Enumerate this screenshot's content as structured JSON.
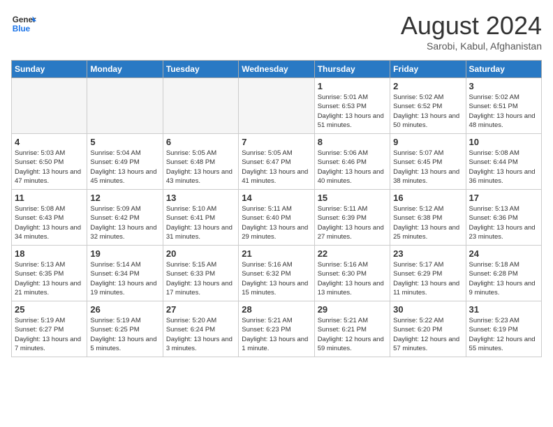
{
  "header": {
    "logo_line1": "General",
    "logo_line2": "Blue",
    "title": "August 2024",
    "subtitle": "Sarobi, Kabul, Afghanistan"
  },
  "days_of_week": [
    "Sunday",
    "Monday",
    "Tuesday",
    "Wednesday",
    "Thursday",
    "Friday",
    "Saturday"
  ],
  "weeks": [
    [
      {
        "num": "",
        "sunrise": "",
        "sunset": "",
        "daylight": "",
        "empty": true
      },
      {
        "num": "",
        "sunrise": "",
        "sunset": "",
        "daylight": "",
        "empty": true
      },
      {
        "num": "",
        "sunrise": "",
        "sunset": "",
        "daylight": "",
        "empty": true
      },
      {
        "num": "",
        "sunrise": "",
        "sunset": "",
        "daylight": "",
        "empty": true
      },
      {
        "num": "1",
        "sunrise": "Sunrise: 5:01 AM",
        "sunset": "Sunset: 6:53 PM",
        "daylight": "Daylight: 13 hours and 51 minutes."
      },
      {
        "num": "2",
        "sunrise": "Sunrise: 5:02 AM",
        "sunset": "Sunset: 6:52 PM",
        "daylight": "Daylight: 13 hours and 50 minutes."
      },
      {
        "num": "3",
        "sunrise": "Sunrise: 5:02 AM",
        "sunset": "Sunset: 6:51 PM",
        "daylight": "Daylight: 13 hours and 48 minutes."
      }
    ],
    [
      {
        "num": "4",
        "sunrise": "Sunrise: 5:03 AM",
        "sunset": "Sunset: 6:50 PM",
        "daylight": "Daylight: 13 hours and 47 minutes."
      },
      {
        "num": "5",
        "sunrise": "Sunrise: 5:04 AM",
        "sunset": "Sunset: 6:49 PM",
        "daylight": "Daylight: 13 hours and 45 minutes."
      },
      {
        "num": "6",
        "sunrise": "Sunrise: 5:05 AM",
        "sunset": "Sunset: 6:48 PM",
        "daylight": "Daylight: 13 hours and 43 minutes."
      },
      {
        "num": "7",
        "sunrise": "Sunrise: 5:05 AM",
        "sunset": "Sunset: 6:47 PM",
        "daylight": "Daylight: 13 hours and 41 minutes."
      },
      {
        "num": "8",
        "sunrise": "Sunrise: 5:06 AM",
        "sunset": "Sunset: 6:46 PM",
        "daylight": "Daylight: 13 hours and 40 minutes."
      },
      {
        "num": "9",
        "sunrise": "Sunrise: 5:07 AM",
        "sunset": "Sunset: 6:45 PM",
        "daylight": "Daylight: 13 hours and 38 minutes."
      },
      {
        "num": "10",
        "sunrise": "Sunrise: 5:08 AM",
        "sunset": "Sunset: 6:44 PM",
        "daylight": "Daylight: 13 hours and 36 minutes."
      }
    ],
    [
      {
        "num": "11",
        "sunrise": "Sunrise: 5:08 AM",
        "sunset": "Sunset: 6:43 PM",
        "daylight": "Daylight: 13 hours and 34 minutes."
      },
      {
        "num": "12",
        "sunrise": "Sunrise: 5:09 AM",
        "sunset": "Sunset: 6:42 PM",
        "daylight": "Daylight: 13 hours and 32 minutes."
      },
      {
        "num": "13",
        "sunrise": "Sunrise: 5:10 AM",
        "sunset": "Sunset: 6:41 PM",
        "daylight": "Daylight: 13 hours and 31 minutes."
      },
      {
        "num": "14",
        "sunrise": "Sunrise: 5:11 AM",
        "sunset": "Sunset: 6:40 PM",
        "daylight": "Daylight: 13 hours and 29 minutes."
      },
      {
        "num": "15",
        "sunrise": "Sunrise: 5:11 AM",
        "sunset": "Sunset: 6:39 PM",
        "daylight": "Daylight: 13 hours and 27 minutes."
      },
      {
        "num": "16",
        "sunrise": "Sunrise: 5:12 AM",
        "sunset": "Sunset: 6:38 PM",
        "daylight": "Daylight: 13 hours and 25 minutes."
      },
      {
        "num": "17",
        "sunrise": "Sunrise: 5:13 AM",
        "sunset": "Sunset: 6:36 PM",
        "daylight": "Daylight: 13 hours and 23 minutes."
      }
    ],
    [
      {
        "num": "18",
        "sunrise": "Sunrise: 5:13 AM",
        "sunset": "Sunset: 6:35 PM",
        "daylight": "Daylight: 13 hours and 21 minutes."
      },
      {
        "num": "19",
        "sunrise": "Sunrise: 5:14 AM",
        "sunset": "Sunset: 6:34 PM",
        "daylight": "Daylight: 13 hours and 19 minutes."
      },
      {
        "num": "20",
        "sunrise": "Sunrise: 5:15 AM",
        "sunset": "Sunset: 6:33 PM",
        "daylight": "Daylight: 13 hours and 17 minutes."
      },
      {
        "num": "21",
        "sunrise": "Sunrise: 5:16 AM",
        "sunset": "Sunset: 6:32 PM",
        "daylight": "Daylight: 13 hours and 15 minutes."
      },
      {
        "num": "22",
        "sunrise": "Sunrise: 5:16 AM",
        "sunset": "Sunset: 6:30 PM",
        "daylight": "Daylight: 13 hours and 13 minutes."
      },
      {
        "num": "23",
        "sunrise": "Sunrise: 5:17 AM",
        "sunset": "Sunset: 6:29 PM",
        "daylight": "Daylight: 13 hours and 11 minutes."
      },
      {
        "num": "24",
        "sunrise": "Sunrise: 5:18 AM",
        "sunset": "Sunset: 6:28 PM",
        "daylight": "Daylight: 13 hours and 9 minutes."
      }
    ],
    [
      {
        "num": "25",
        "sunrise": "Sunrise: 5:19 AM",
        "sunset": "Sunset: 6:27 PM",
        "daylight": "Daylight: 13 hours and 7 minutes."
      },
      {
        "num": "26",
        "sunrise": "Sunrise: 5:19 AM",
        "sunset": "Sunset: 6:25 PM",
        "daylight": "Daylight: 13 hours and 5 minutes."
      },
      {
        "num": "27",
        "sunrise": "Sunrise: 5:20 AM",
        "sunset": "Sunset: 6:24 PM",
        "daylight": "Daylight: 13 hours and 3 minutes."
      },
      {
        "num": "28",
        "sunrise": "Sunrise: 5:21 AM",
        "sunset": "Sunset: 6:23 PM",
        "daylight": "Daylight: 13 hours and 1 minute."
      },
      {
        "num": "29",
        "sunrise": "Sunrise: 5:21 AM",
        "sunset": "Sunset: 6:21 PM",
        "daylight": "Daylight: 12 hours and 59 minutes."
      },
      {
        "num": "30",
        "sunrise": "Sunrise: 5:22 AM",
        "sunset": "Sunset: 6:20 PM",
        "daylight": "Daylight: 12 hours and 57 minutes."
      },
      {
        "num": "31",
        "sunrise": "Sunrise: 5:23 AM",
        "sunset": "Sunset: 6:19 PM",
        "daylight": "Daylight: 12 hours and 55 minutes."
      }
    ]
  ]
}
